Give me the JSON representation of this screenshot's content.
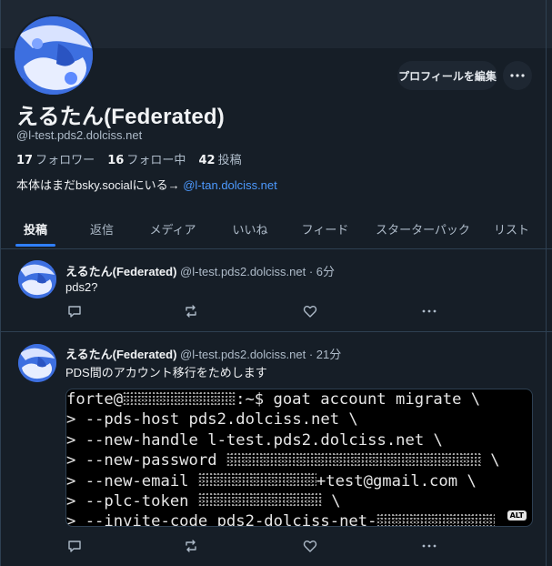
{
  "profile": {
    "display_name": "えるたん(Federated)",
    "handle": "@l-test.pds2.dolciss.net",
    "followers_count": "17",
    "followers_label": "フォロワー",
    "following_count": "16",
    "following_label": "フォロー中",
    "posts_count": "42",
    "posts_label": "投稿",
    "bio_text": "本体はまだbsky.socialにいる→ ",
    "bio_link": "@l-tan.dolciss.net",
    "edit_profile_label": "プロフィールを編集",
    "more_label": "…"
  },
  "tabs": [
    {
      "label": "投稿"
    },
    {
      "label": "返信"
    },
    {
      "label": "メディア"
    },
    {
      "label": "いいね"
    },
    {
      "label": "フィード"
    },
    {
      "label": "スターターパック"
    },
    {
      "label": "リスト"
    }
  ],
  "posts": [
    {
      "author": "えるたん(Federated)",
      "handle": "@l-test.pds2.dolciss.net",
      "time": " · 6分",
      "text": "pds2?"
    },
    {
      "author": "えるたん(Federated)",
      "handle": "@l-test.pds2.dolciss.net",
      "time": " · 21分",
      "text": "PDS間のアカウント移行をためします",
      "image": {
        "lines": [
          {
            "pre": "forte@",
            "post": ":~$ goat account migrate \\"
          },
          {
            "pre": "> --pds-host pds2.dolciss.net \\",
            "post": ""
          },
          {
            "pre": "> --new-handle l-test.pds2.dolciss.net \\",
            "post": ""
          },
          {
            "pre": "> --new-password ",
            "post": " \\"
          },
          {
            "pre": "> --new-email ",
            "post": "+test@gmail.com \\"
          },
          {
            "pre": "> --plc-token ",
            "post": " \\"
          },
          {
            "pre": "> --invite-code pds2-dolciss-net-",
            "post": ""
          }
        ],
        "alt_badge": "ALT"
      }
    }
  ],
  "icons": {
    "more": "more-horizontal-icon",
    "reply": "reply-icon",
    "repost": "repost-icon",
    "like": "like-icon"
  },
  "colors": {
    "background": "#161e27",
    "panel": "#1e2732",
    "accent": "#2f7fff",
    "link": "#4d9aff",
    "muted": "#aebbc9"
  }
}
